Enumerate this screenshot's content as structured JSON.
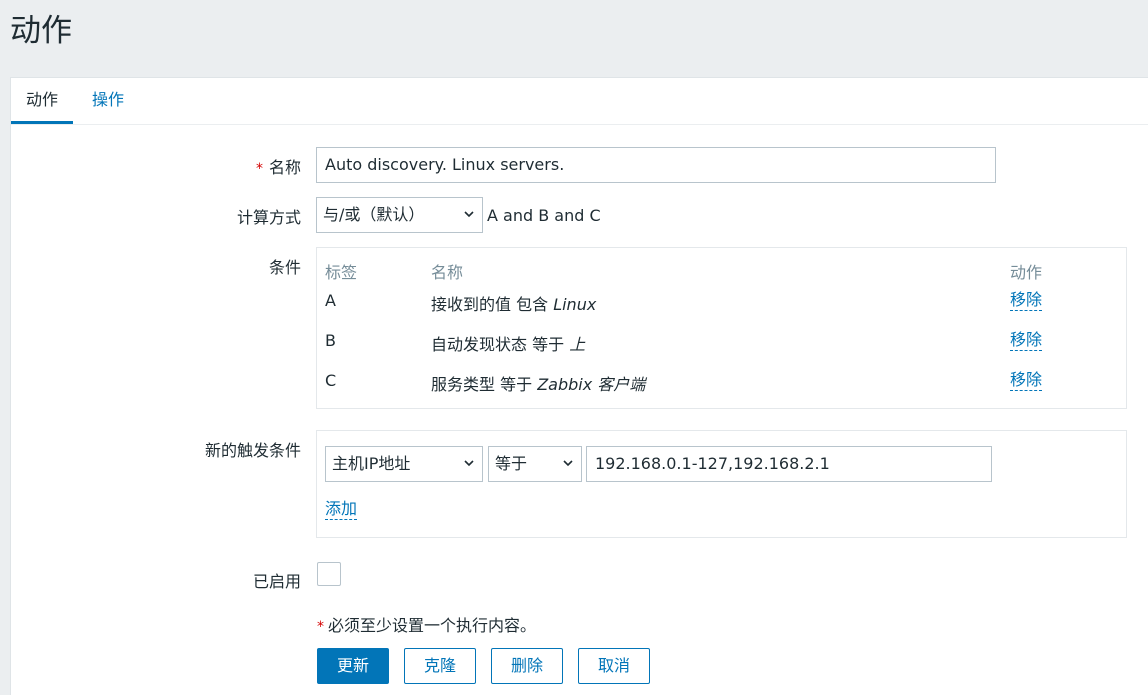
{
  "page": {
    "title": "动作"
  },
  "tabs": [
    {
      "label": "动作",
      "active": true
    },
    {
      "label": "操作",
      "active": false
    }
  ],
  "form": {
    "name": {
      "label": "名称",
      "required_mark": "*",
      "value": "Auto discovery. Linux servers."
    },
    "calc": {
      "label": "计算方式",
      "selected": "与/或（默认）",
      "expression": "A and B and C"
    },
    "conditions": {
      "label": "条件",
      "headers": {
        "tag": "标签",
        "name": "名称",
        "action": "动作"
      },
      "rows": [
        {
          "tag": "A",
          "text": "接收到的值 包含 ",
          "value": "Linux",
          "remove": "移除"
        },
        {
          "tag": "B",
          "text": "自动发现状态 等于 ",
          "value": "上",
          "remove": "移除"
        },
        {
          "tag": "C",
          "text": "服务类型 等于 ",
          "value": "Zabbix 客户端",
          "remove": "移除"
        }
      ]
    },
    "new_condition": {
      "label": "新的触发条件",
      "type_selected": "主机IP地址",
      "operator_selected": "等于",
      "value": "192.168.0.1-127,192.168.2.1",
      "add_label": "添加"
    },
    "enabled": {
      "label": "已启用",
      "checked": false
    },
    "note": {
      "mark": "*",
      "text": "必须至少设置一个执行内容。"
    }
  },
  "buttons": {
    "update": "更新",
    "clone": "克隆",
    "delete": "删除",
    "cancel": "取消"
  },
  "colors": {
    "accent": "#0275b8",
    "required": "#d40000",
    "background": "#ebeef0"
  }
}
